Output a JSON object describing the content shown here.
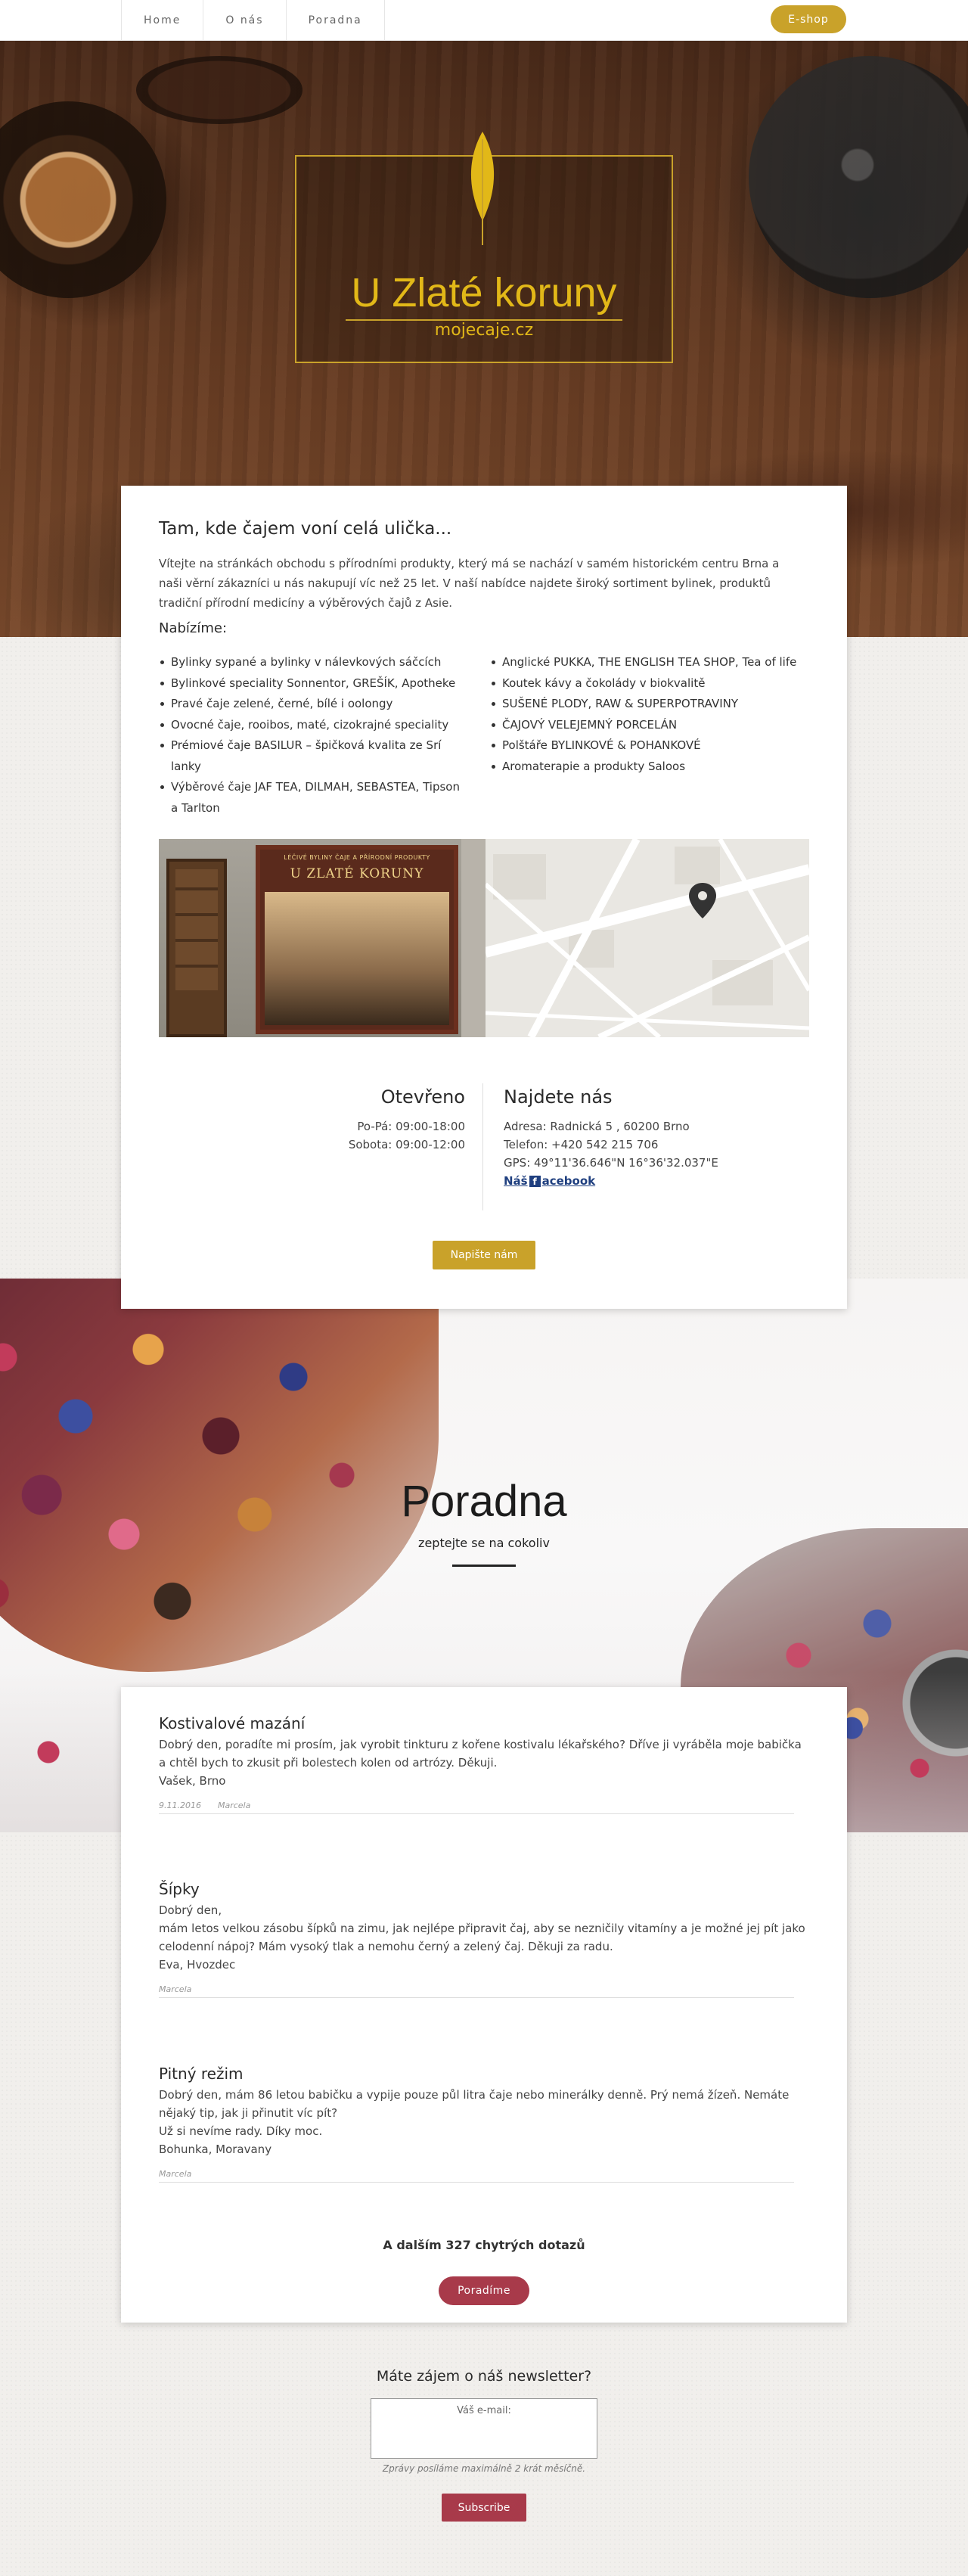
{
  "nav": {
    "items": [
      "Home",
      "O nás",
      "Poradna"
    ],
    "eshop_label": "E-shop"
  },
  "hero": {
    "title": "U Zlaté koruny",
    "subtitle": "mojecaje.cz"
  },
  "about": {
    "title": "Tam, kde čajem voní celá ulička...",
    "text": "Vítejte na stránkách obchodu s přírodními produkty, který má se nachází v samém historickém centru Brna a naši věrní zákazníci u nás nakupují víc než 25 let. V naší nabídce najdete široký sortiment bylinek, produktů tradiční přírodní medicíny a výběrových čajů z Asie.",
    "offer_title": "Nabízíme:",
    "offer_left": [
      "Bylinky sypané a bylinky v nálevkových sáčcích",
      "Bylinkové speciality Sonnentor, GREŠÍK, Apotheke",
      "Pravé čaje zelené, černé, bílé i oolongy",
      "Ovocné čaje, rooibos, maté, cizokrajné speciality",
      "Prémiové čaje BASILUR – špičková kvalita ze Srí lanky",
      "Výběrové čaje JAF TEA, DILMAH, SEBASTEA, Tipson a Tarlton"
    ],
    "offer_right": [
      "Anglické PUKKA, THE ENGLISH TEA SHOP, Tea of life",
      "Koutek kávy a čokolády v biokvalitě",
      "SUŠENÉ PLODY, RAW & SUPERPOTRAVINY",
      "ČAJOVÝ VELEJEMNÝ PORCELÁN",
      "Polštáře BYLINKOVÉ & POHANKOVÉ",
      "Aromaterapie a produkty Saloos"
    ],
    "shop_sign_small": "LÉČIVÉ BYLINY ČAJE A PŘÍRODNÍ PRODUKTY",
    "shop_sign": "U ZLATÉ KORUNY"
  },
  "hours": {
    "title": "Otevřeno",
    "lines": [
      "Po-Pá: 09:00-18:00",
      "Sobota: 09:00-12:00"
    ]
  },
  "contact": {
    "title": "Najdete nás",
    "address": "Adresa: Radnická 5 , 60200 Brno",
    "phone": "Telefon: +420 542 215 706",
    "gps": "GPS: 49°11'36.646\"N 16°36'32.037\"E",
    "fb_prefix": "Náš",
    "fb_label": "acebook",
    "write_button": "Napište nám"
  },
  "advice": {
    "title": "Poradna",
    "subtitle": "zeptejte se na cokoliv",
    "questions": [
      {
        "title": "Kostivalové mazání",
        "body": "Dobrý den, poradíte mi prosím, jak vyrobit tinkturu z kořene kostivalu lékařského? Dříve ji vyráběla moje babička a chtěl bych to zkusit při bolestech kolen od artrózy. Děkuji.",
        "author": "Vašek, Brno",
        "date": "9.11.2016",
        "answered_by": "Marcela"
      },
      {
        "title": "Šípky",
        "body": "Dobrý den,\nmám letos velkou zásobu šípků na zimu, jak nejlépe připravit čaj, aby se nezničily vitamíny a je možné jej pít jako celodenní nápoj? Mám vysoký tlak a nemohu černý a zelený čaj. Děkuji za radu.",
        "author": "Eva, Hvozdec",
        "answered_by": "Marcela"
      },
      {
        "title": "Pitný režim",
        "body": "Dobrý den, mám 86 letou babičku a vypije pouze půl litra čaje nebo minerálky denně. Prý nemá žízeň. Nemáte nějaký tip, jak ji přinutit víc pít?\nUž si nevíme rady. Díky moc.",
        "author": "Bohunka, Moravany",
        "answered_by": "Marcela"
      }
    ],
    "more_text": "A dalším 327 chytrých dotazů",
    "advise_button": "Poradíme"
  },
  "newsletter": {
    "title": "Máte zájem o náš newsletter?",
    "email_placeholder": "Váš e-mail:",
    "note": "Zprávy posíláme maximálně 2 krát měsíčně.",
    "subscribe_label": "Subscribe"
  },
  "colors": {
    "gold": "#c9a22a",
    "berry": "#a83a4a",
    "facebook": "#1f3f7f"
  }
}
